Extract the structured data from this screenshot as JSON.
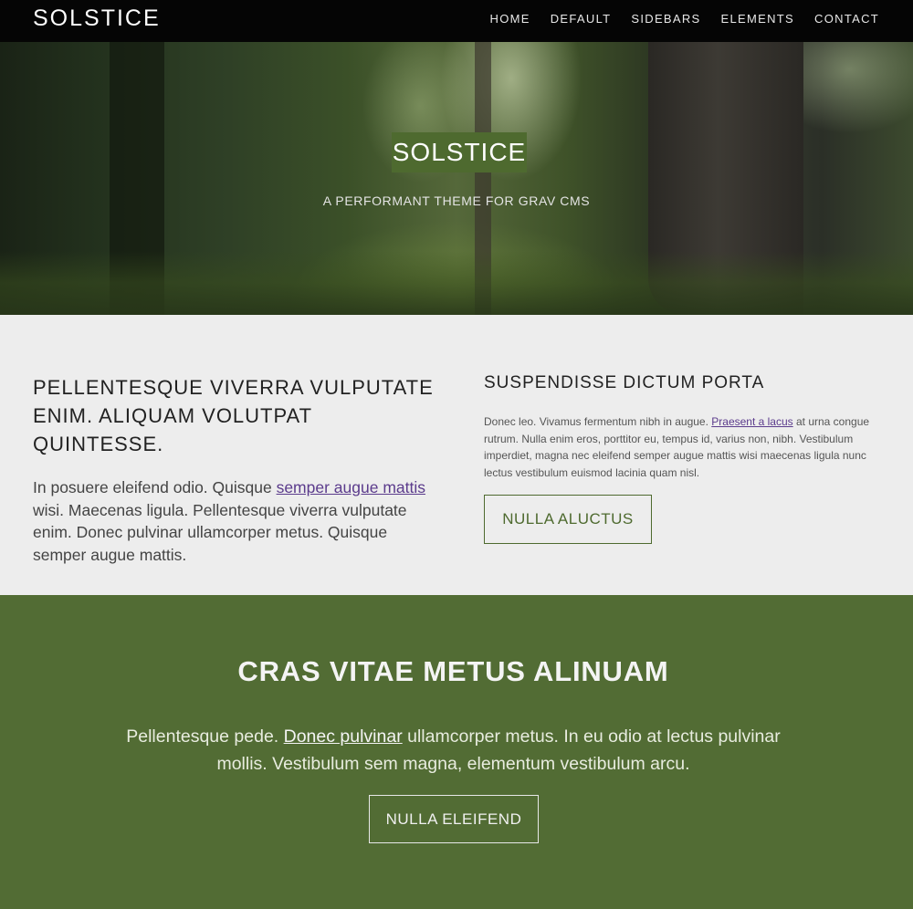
{
  "header": {
    "brand": "SOLSTICE",
    "nav": [
      "HOME",
      "DEFAULT",
      "SIDEBARS",
      "ELEMENTS",
      "CONTACT"
    ]
  },
  "hero": {
    "title": "SOLSTICE",
    "subtitle": "A PERFORMANT THEME FOR GRAV CMS"
  },
  "left": {
    "heading": "PELLENTESQUE VIVERRA VULPUTATE ENIM. ALIQUAM VOLUTPAT QUINTESSE.",
    "text_before": "In posuere eleifend odio. Quisque ",
    "link": "semper augue mattis",
    "text_after": " wisi. Maecenas ligula. Pellentesque viverra vulputate enim. Donec pulvinar ullamcorper metus. Quisque semper augue mattis."
  },
  "right": {
    "heading": "SUSPENDISSE DICTUM PORTA",
    "text_before": "Donec leo. Vivamus fermentum nibh in augue. ",
    "link": "Praesent a lacus",
    "text_after": " at urna congue rutrum. Nulla enim eros, porttitor eu, tempus id, varius non, nibh. Vestibulum imperdiet, magna nec eleifend semper augue mattis wisi maecenas ligula nunc lectus vestibulum euismod lacinia quam nisl.",
    "button": "NULLA ALUCTUS"
  },
  "banner": {
    "heading": "CRAS VITAE METUS ALINUAM",
    "text_before": "Pellentesque pede. ",
    "link": "Donec pulvinar",
    "text_after": " ullamcorper metus. In eu odio at lectus pulvinar mollis. Vestibulum sem magna, elementum vestibulum arcu.",
    "button": "NULLA ELEIFEND"
  },
  "colors": {
    "accent_green": "#526c34",
    "header_bg": "#050505",
    "section_bg": "#ededed",
    "link_purple": "#5b3b8c"
  }
}
